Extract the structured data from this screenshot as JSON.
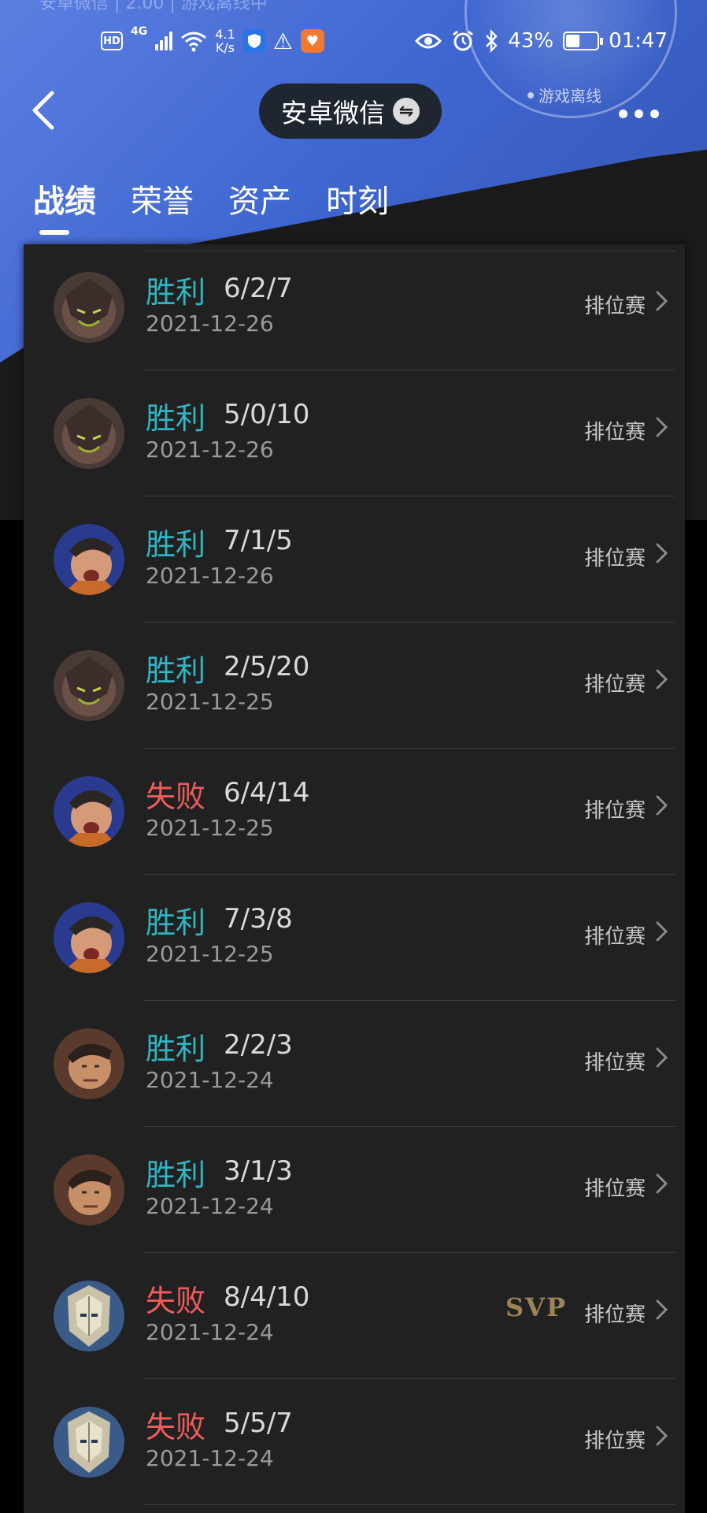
{
  "background": {
    "faded_text": "安卓微信 | 2.00 | 游戏离线中"
  },
  "status_bar": {
    "network": "4G",
    "hd": "HD",
    "speed_value": "4.1",
    "speed_unit": "K/s",
    "battery_percent": "43%",
    "time": "01:47",
    "battery_level": 0.43
  },
  "nav": {
    "account_label": "安卓微信",
    "swap_icon": "⇋",
    "offline_status": "游戏离线"
  },
  "tabs": [
    {
      "label": "战绩",
      "active": true
    },
    {
      "label": "荣誉",
      "active": false
    },
    {
      "label": "资产",
      "active": false
    },
    {
      "label": "时刻",
      "active": false
    }
  ],
  "matches": [
    {
      "result": "胜利",
      "outcome": "win",
      "kda": "6/2/7",
      "date": "2021-12-26",
      "mode": "排位赛",
      "hero": "dark-hero",
      "svp": ""
    },
    {
      "result": "胜利",
      "outcome": "win",
      "kda": "5/0/10",
      "date": "2021-12-26",
      "mode": "排位赛",
      "hero": "dark-hero",
      "svp": ""
    },
    {
      "result": "胜利",
      "outcome": "win",
      "kda": "7/1/5",
      "date": "2021-12-26",
      "mode": "排位赛",
      "hero": "shout-hero",
      "svp": ""
    },
    {
      "result": "胜利",
      "outcome": "win",
      "kda": "2/5/20",
      "date": "2021-12-25",
      "mode": "排位赛",
      "hero": "dark-hero",
      "svp": ""
    },
    {
      "result": "失败",
      "outcome": "lose",
      "kda": "6/4/14",
      "date": "2021-12-25",
      "mode": "排位赛",
      "hero": "shout-hero",
      "svp": ""
    },
    {
      "result": "胜利",
      "outcome": "win",
      "kda": "7/3/8",
      "date": "2021-12-25",
      "mode": "排位赛",
      "hero": "shout-hero",
      "svp": ""
    },
    {
      "result": "胜利",
      "outcome": "win",
      "kda": "2/2/3",
      "date": "2021-12-24",
      "mode": "排位赛",
      "hero": "warrior-hero",
      "svp": ""
    },
    {
      "result": "胜利",
      "outcome": "win",
      "kda": "3/1/3",
      "date": "2021-12-24",
      "mode": "排位赛",
      "hero": "warrior-hero",
      "svp": ""
    },
    {
      "result": "失败",
      "outcome": "lose",
      "kda": "8/4/10",
      "date": "2021-12-24",
      "mode": "排位赛",
      "hero": "armor-hero",
      "svp": "SVP"
    },
    {
      "result": "失败",
      "outcome": "lose",
      "kda": "5/5/7",
      "date": "2021-12-24",
      "mode": "排位赛",
      "hero": "armor-hero",
      "svp": ""
    }
  ],
  "colors": {
    "win": "#2fb6c2",
    "lose": "#f15b5b",
    "svp": "#9d8458",
    "accent_blue": "#3f67d2"
  }
}
